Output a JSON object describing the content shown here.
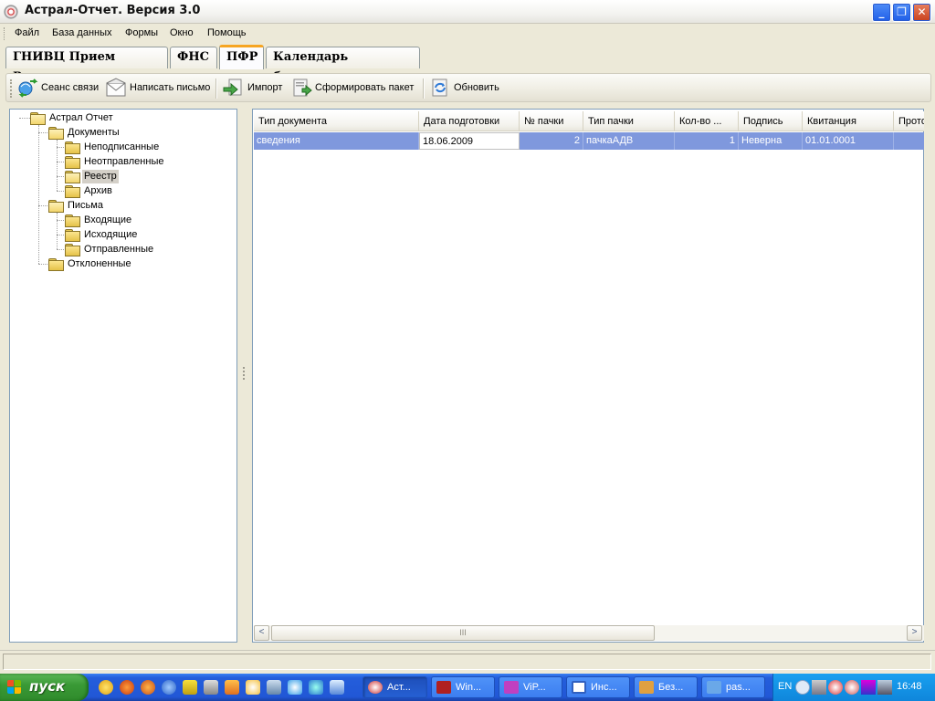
{
  "window": {
    "title": "Астрал-Отчет.  Версия 3.0",
    "controls": {
      "minimize": "_",
      "maximize": "❐",
      "close": "✕"
    }
  },
  "menu": [
    "Файл",
    "База данных",
    "Формы",
    "Окно",
    "Помощь"
  ],
  "tabs": [
    {
      "label": "ГНИВЦ Прием Регион",
      "active": false
    },
    {
      "label": "ФНС",
      "active": false
    },
    {
      "label": "ПФР",
      "active": true
    },
    {
      "label": "Календарь бухгалтера",
      "active": false
    }
  ],
  "toolbar": [
    {
      "label": "Сеанс связи",
      "icon": "connection-session-icon"
    },
    {
      "label": "Написать письмо",
      "icon": "envelope-icon"
    },
    {
      "label": "Импорт",
      "icon": "import-icon"
    },
    {
      "label": "Сформировать пакет",
      "icon": "build-package-icon"
    },
    {
      "label": "Обновить",
      "icon": "refresh-icon"
    }
  ],
  "tree": {
    "root": "Астрал Отчет",
    "documents": "Документы",
    "doc_children": [
      "Неподписанные",
      "Неотправленные",
      "Реестр",
      "Архив"
    ],
    "letters": "Письма",
    "letter_children": [
      "Входящие",
      "Исходящие",
      "Отправленные"
    ],
    "rejected": "Отклоненные",
    "selected": "Реестр"
  },
  "grid": {
    "columns": [
      "Тип документа",
      "Дата подготовки",
      "№ пачки",
      "Тип пачки",
      "Кол-во ...",
      "Подпись",
      "Квитанция",
      "Прото"
    ],
    "rows": [
      [
        "сведения",
        "18.06.2009",
        "2",
        "пачкаАДВ",
        "1",
        "Неверна",
        "01.01.0001",
        ""
      ]
    ],
    "scroll_thumb_glyph": "III",
    "scroll_left": "<",
    "scroll_right": ">"
  },
  "taskbar": {
    "start_label": "пуск",
    "tasks": [
      {
        "label": "Аст...",
        "active": true,
        "icon_color": "#d0d0d0"
      },
      {
        "label": "Win...",
        "active": false,
        "icon_color": "#b02020"
      },
      {
        "label": "ViP...",
        "active": false,
        "icon_color": "#c040c0"
      },
      {
        "label": "Инс...",
        "active": false,
        "icon_color": "#3060c0"
      },
      {
        "label": "Без...",
        "active": false,
        "icon_color": "#e0a040"
      },
      {
        "label": "pas...",
        "active": false,
        "icon_color": "#6aa8e8"
      }
    ],
    "language": "EN",
    "clock": "16:48"
  },
  "colors": {
    "selection": "#7f98dd",
    "active_tab_accent": "#f6a522",
    "taskbar": "#245edb",
    "start": "#3a9a36"
  }
}
